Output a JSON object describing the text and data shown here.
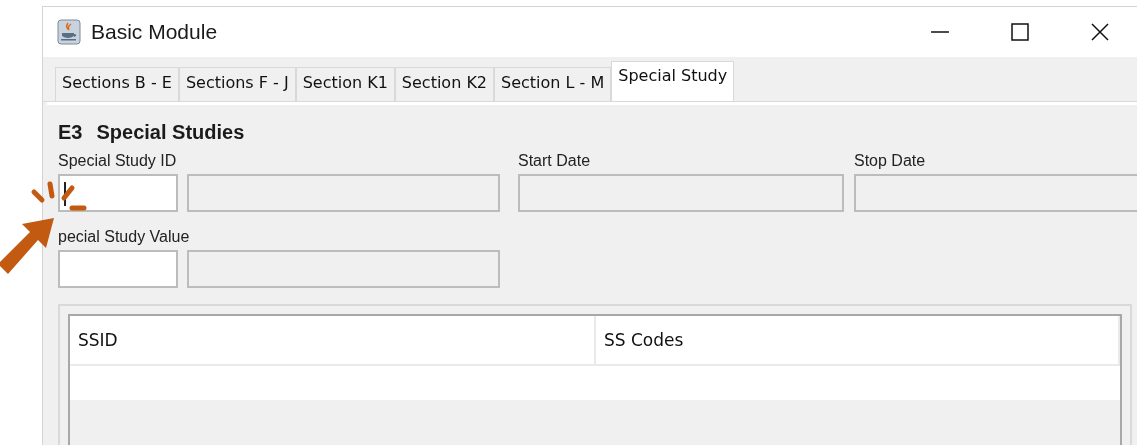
{
  "window": {
    "title": "Basic Module"
  },
  "tabs": [
    {
      "label": "Sections B - E",
      "selected": false
    },
    {
      "label": "Sections F - J",
      "selected": false
    },
    {
      "label": "Section K1",
      "selected": false
    },
    {
      "label": "Section K2",
      "selected": false
    },
    {
      "label": "Section L - M",
      "selected": false
    },
    {
      "label": "Special Study",
      "selected": true
    }
  ],
  "heading": {
    "code": "E3",
    "title": "Special Studies"
  },
  "field_rows": [
    {
      "groups": [
        {
          "label": "Special Study ID",
          "inputs": [
            {
              "disabled": false,
              "focused": true
            },
            {
              "disabled": true,
              "focused": false
            }
          ]
        },
        {
          "label": "Start Date",
          "inputs": [
            {
              "disabled": true,
              "focused": false
            }
          ]
        },
        {
          "label": "Stop Date",
          "inputs": [
            {
              "disabled": true,
              "focused": false
            }
          ]
        }
      ]
    },
    {
      "groups": [
        {
          "label": "pecial Study Value",
          "inputs": [
            {
              "disabled": false,
              "focused": false
            },
            {
              "disabled": true,
              "focused": false
            }
          ]
        }
      ]
    }
  ],
  "table": {
    "columns": [
      "SSID",
      "SS Codes"
    ]
  }
}
